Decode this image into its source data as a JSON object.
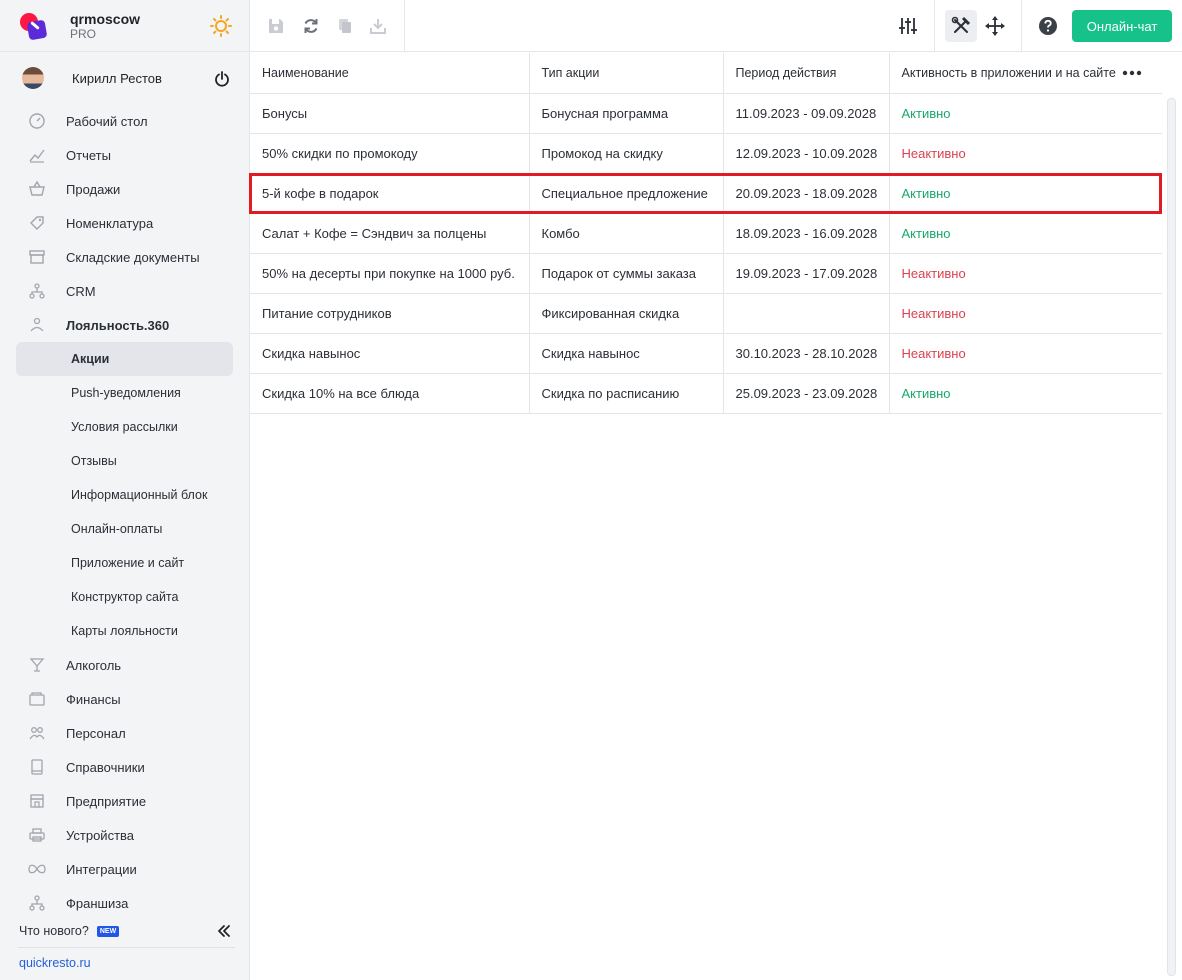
{
  "brand": {
    "name": "qrmoscow",
    "plan": "PRO"
  },
  "user": {
    "name": "Кирилл Рестов"
  },
  "nav": [
    {
      "label": "Рабочий стол",
      "icon": "dashboard-icon"
    },
    {
      "label": "Отчеты",
      "icon": "chart-icon"
    },
    {
      "label": "Продажи",
      "icon": "basket-icon"
    },
    {
      "label": "Номенклатура",
      "icon": "tag-icon"
    },
    {
      "label": "Складские документы",
      "icon": "archive-icon"
    },
    {
      "label": "CRM",
      "icon": "hierarchy-icon"
    },
    {
      "label": "Лояльность.360",
      "icon": "loyalty-icon"
    }
  ],
  "loyalty_sub": [
    "Акции",
    "Push-уведомления",
    "Условия рассылки",
    "Отзывы",
    "Информационный блок",
    "Онлайн-оплаты",
    "Приложение и сайт",
    "Конструктор сайта",
    "Карты лояльности"
  ],
  "nav_bottom": [
    {
      "label": "Алкоголь",
      "icon": "cocktail-icon"
    },
    {
      "label": "Финансы",
      "icon": "wallet-icon"
    },
    {
      "label": "Персонал",
      "icon": "people-icon"
    },
    {
      "label": "Справочники",
      "icon": "book-icon"
    },
    {
      "label": "Предприятие",
      "icon": "store-icon"
    },
    {
      "label": "Устройства",
      "icon": "printer-icon"
    },
    {
      "label": "Интеграции",
      "icon": "infinity-icon"
    },
    {
      "label": "Франшиза",
      "icon": "hierarchy-icon"
    }
  ],
  "footer": {
    "whats_new": "Что нового?",
    "badge": "NEW",
    "site": "quickresto.ru"
  },
  "toolbar": {
    "chat_label": "Онлайн-чат"
  },
  "table": {
    "headers": [
      "Наименование",
      "Тип акции",
      "Период действия",
      "Активность в приложении и на сайте"
    ],
    "rows": [
      {
        "name": "Бонусы",
        "type": "Бонусная программа",
        "period": "11.09.2023 - 09.09.2028",
        "status": "Активно",
        "active": true
      },
      {
        "name": "50% скидки по промокоду",
        "type": "Промокод на скидку",
        "period": "12.09.2023 - 10.09.2028",
        "status": "Неактивно",
        "active": false
      },
      {
        "name": "5-й кофе в подарок",
        "type": "Специальное предложение",
        "period": "20.09.2023 - 18.09.2028",
        "status": "Активно",
        "active": true
      },
      {
        "name": "Салат + Кофе = Сэндвич за полцены",
        "type": "Комбо",
        "period": "18.09.2023 - 16.09.2028",
        "status": "Активно",
        "active": true
      },
      {
        "name": "50% на десерты при покупке на 1000 руб.",
        "type": "Подарок от суммы заказа",
        "period": "19.09.2023 - 17.09.2028",
        "status": "Неактивно",
        "active": false
      },
      {
        "name": "Питание сотрудников",
        "type": "Фиксированная скидка",
        "period": "",
        "status": "Неактивно",
        "active": false
      },
      {
        "name": "Скидка навынос",
        "type": "Скидка навынос",
        "period": "30.10.2023 - 28.10.2028",
        "status": "Неактивно",
        "active": false
      },
      {
        "name": "Скидка 10% на все блюда",
        "type": "Скидка по расписанию",
        "period": "25.09.2023 - 23.09.2028",
        "status": "Активно",
        "active": true
      }
    ]
  },
  "colors": {
    "accent": "#17c18a",
    "active": "#19a86b",
    "inactive": "#d9434f",
    "highlight": "#e01b24"
  }
}
